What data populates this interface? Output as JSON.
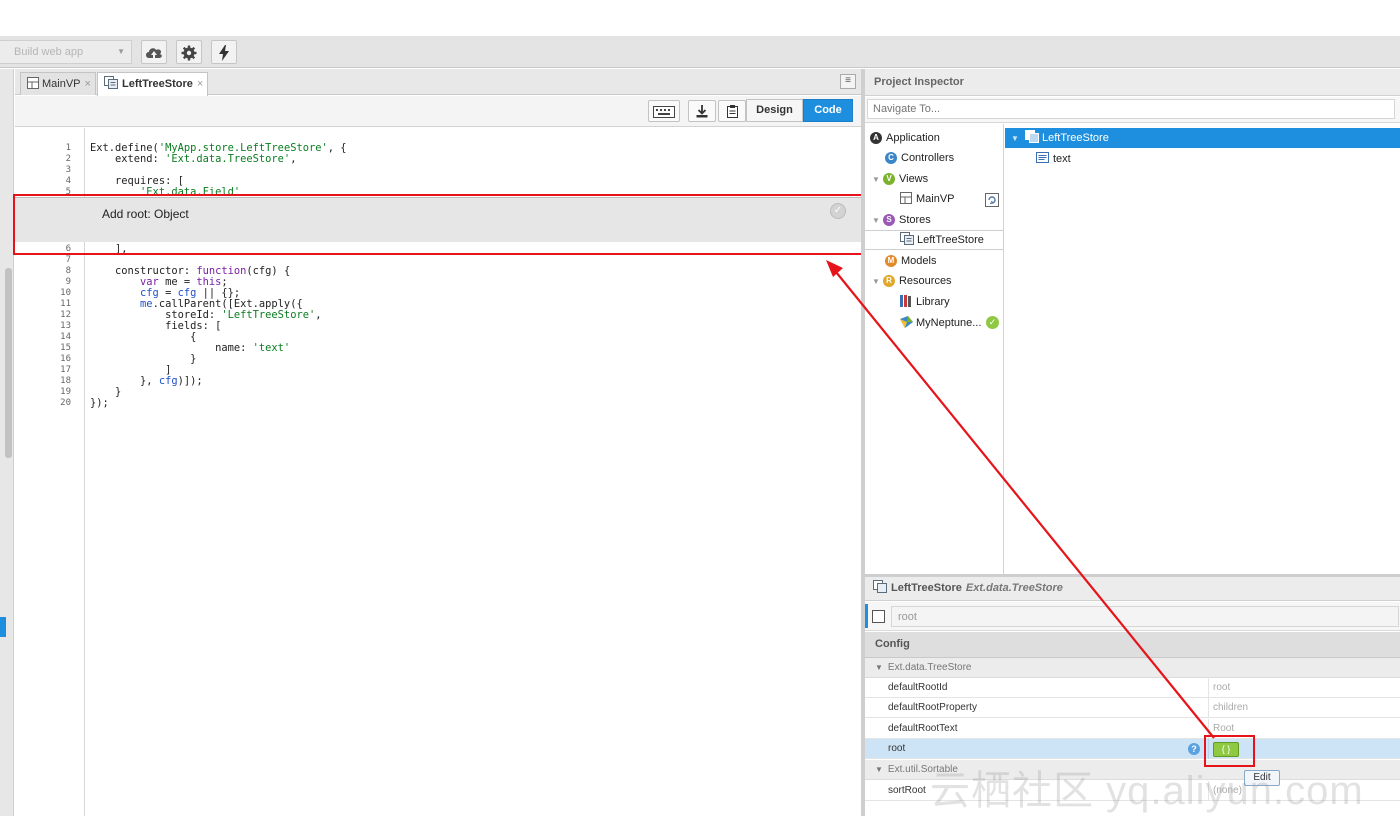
{
  "toolbar": {
    "build_select": "Build web app",
    "icons": [
      "cloud-upload-icon",
      "gear-icon",
      "lightning-icon"
    ]
  },
  "editor": {
    "tabs": [
      {
        "label": "MainVP",
        "active": false
      },
      {
        "label": "LeftTreeStore",
        "active": true
      }
    ],
    "close_glyph": "×",
    "design_label": "Design",
    "code_label": "Code",
    "line_numbers": [
      "1",
      "2",
      "3",
      "4",
      "5",
      "6",
      "7",
      "8",
      "9",
      "10",
      "11",
      "12",
      "13",
      "14",
      "15",
      "16",
      "17",
      "18",
      "19",
      "20"
    ],
    "root_tooltip_label": "Add root: Object"
  },
  "project_inspector": {
    "title": "Project Inspector",
    "navigate_placeholder": "Navigate To...",
    "tree": {
      "application": "Application",
      "controllers": "Controllers",
      "views": "Views",
      "mainvp": "MainVP",
      "stores": "Stores",
      "lefttreestore": "LeftTreeStore",
      "models": "Models",
      "resources": "Resources",
      "library": "Library",
      "myneptune": "MyNeptune..."
    },
    "detail": {
      "store": "LeftTreeStore",
      "field": "text"
    }
  },
  "properties": {
    "header_name": "LeftTreeStore",
    "header_class": "Ext.data.TreeStore",
    "filter_value": "root",
    "config_label": "Config",
    "groups": {
      "treestore": "Ext.data.TreeStore",
      "sortable": "Ext.util.Sortable"
    },
    "rows": {
      "defaultRootId": {
        "name": "defaultRootId",
        "value": "root"
      },
      "defaultRootProperty": {
        "name": "defaultRootProperty",
        "value": "children"
      },
      "defaultRootText": {
        "name": "defaultRootText",
        "value": "Root"
      },
      "root": {
        "name": "root",
        "value": ""
      },
      "sortRoot": {
        "name": "sortRoot",
        "value": "(none)"
      }
    },
    "help_glyph": "?",
    "edit_tooltip": "Edit"
  },
  "watermark": "云栖社区 yq.aliyun.com",
  "colors": {
    "accent": "#1e8fde",
    "annotation_red": "#e6141a",
    "object_button": "#8fc841"
  }
}
